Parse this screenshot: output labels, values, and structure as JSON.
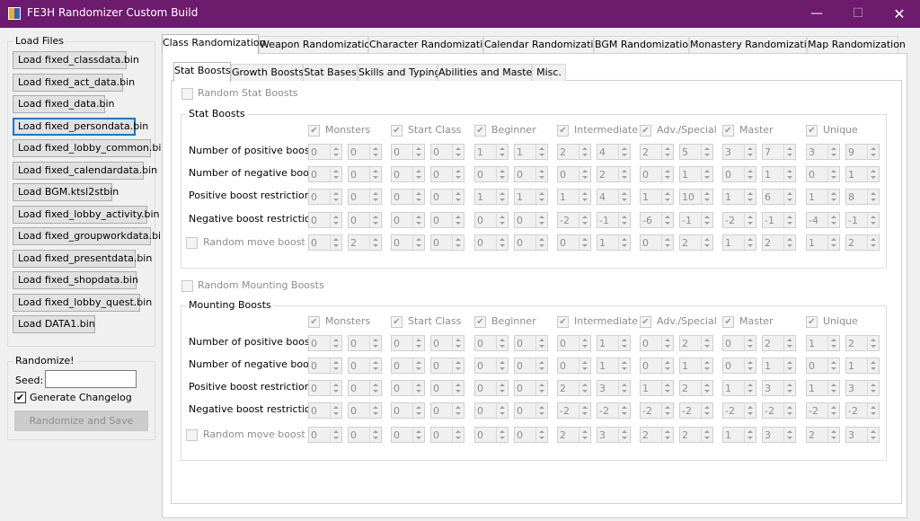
{
  "window": {
    "title": "FE3H Randomizer Custom Build",
    "min": "—",
    "max": "☐",
    "close": "✕"
  },
  "load_files": {
    "title": "Load Files",
    "buttons": [
      "Load fixed_classdata.bin",
      "Load fixed_act_data.bin",
      "Load fixed_data.bin",
      "Load fixed_persondata.bin",
      "Load fixed_lobby_common.bin",
      "Load fixed_calendardata.bin",
      "Load BGM.ktsl2stbin",
      "Load fixed_lobby_activity.bin",
      "Load fixed_groupworkdata.bin",
      "Load fixed_presentdata.bin",
      "Load fixed_shopdata.bin",
      "Load fixed_lobby_quest.bin",
      "Load DATA1.bin"
    ]
  },
  "randomize": {
    "title": "Randomize!",
    "seed_label": "Seed:",
    "seed_value": "",
    "changelog_label": "Generate Changelog",
    "changelog_checked": true,
    "button": "Randomize and Save"
  },
  "main_tabs": [
    "Class Randomization",
    "Weapon Randomization",
    "Character Randomization",
    "Calendar Randomization",
    "BGM Randomization",
    "Monastery Randomization",
    "Map Randomization"
  ],
  "sub_tabs": [
    "Stat Boosts",
    "Growth Boosts",
    "Stat Bases",
    "Skills and Typing",
    "Abilities and Mastery",
    "Misc."
  ],
  "stat_boosts": {
    "toggle_label": "Random Stat Boosts",
    "title": "Stat Boosts",
    "columns": [
      "Monsters",
      "Start Class",
      "Beginner",
      "Intermediate",
      "Adv./Special",
      "Master",
      "Unique"
    ],
    "rows": [
      {
        "label": "Number of positive boosts",
        "values": [
          "0",
          "0",
          "0",
          "0",
          "1",
          "1",
          "2",
          "4",
          "2",
          "5",
          "3",
          "7",
          "3",
          "9"
        ]
      },
      {
        "label": "Number of negative boosts",
        "values": [
          "0",
          "0",
          "0",
          "0",
          "0",
          "0",
          "0",
          "2",
          "0",
          "1",
          "0",
          "1",
          "0",
          "1"
        ]
      },
      {
        "label": "Positive boost restrictions",
        "values": [
          "0",
          "0",
          "0",
          "0",
          "1",
          "1",
          "1",
          "4",
          "1",
          "10",
          "1",
          "6",
          "1",
          "8"
        ]
      },
      {
        "label": "Negative boost restrictions",
        "values": [
          "0",
          "0",
          "0",
          "0",
          "0",
          "0",
          "-2",
          "-1",
          "-6",
          "-1",
          "-2",
          "-1",
          "-4",
          "-1"
        ]
      },
      {
        "label": "Random move boost",
        "values": [
          "0",
          "2",
          "0",
          "0",
          "0",
          "0",
          "0",
          "1",
          "0",
          "2",
          "1",
          "2",
          "1",
          "2"
        ]
      }
    ]
  },
  "mounting_boosts": {
    "toggle_label": "Random Mounting Boosts",
    "title": "Mounting Boosts",
    "columns": [
      "Monsters",
      "Start Class",
      "Beginner",
      "Intermediate",
      "Adv./Special",
      "Master",
      "Unique"
    ],
    "rows": [
      {
        "label": "Number of positive boosts",
        "values": [
          "0",
          "0",
          "0",
          "0",
          "0",
          "0",
          "0",
          "1",
          "0",
          "2",
          "0",
          "2",
          "1",
          "2"
        ]
      },
      {
        "label": "Number of negative boosts",
        "values": [
          "0",
          "0",
          "0",
          "0",
          "0",
          "0",
          "0",
          "1",
          "0",
          "1",
          "0",
          "1",
          "0",
          "1"
        ]
      },
      {
        "label": "Positive boost restrictions",
        "values": [
          "0",
          "0",
          "0",
          "0",
          "0",
          "0",
          "2",
          "3",
          "1",
          "2",
          "1",
          "3",
          "1",
          "3"
        ]
      },
      {
        "label": "Negative boost restrictions",
        "values": [
          "0",
          "0",
          "0",
          "0",
          "0",
          "0",
          "-2",
          "-2",
          "-2",
          "-2",
          "-2",
          "-2",
          "-2",
          "-2"
        ]
      },
      {
        "label": "Random move boost",
        "values": [
          "0",
          "0",
          "0",
          "0",
          "0",
          "0",
          "2",
          "3",
          "2",
          "2",
          "1",
          "3",
          "2",
          "3"
        ]
      }
    ]
  }
}
